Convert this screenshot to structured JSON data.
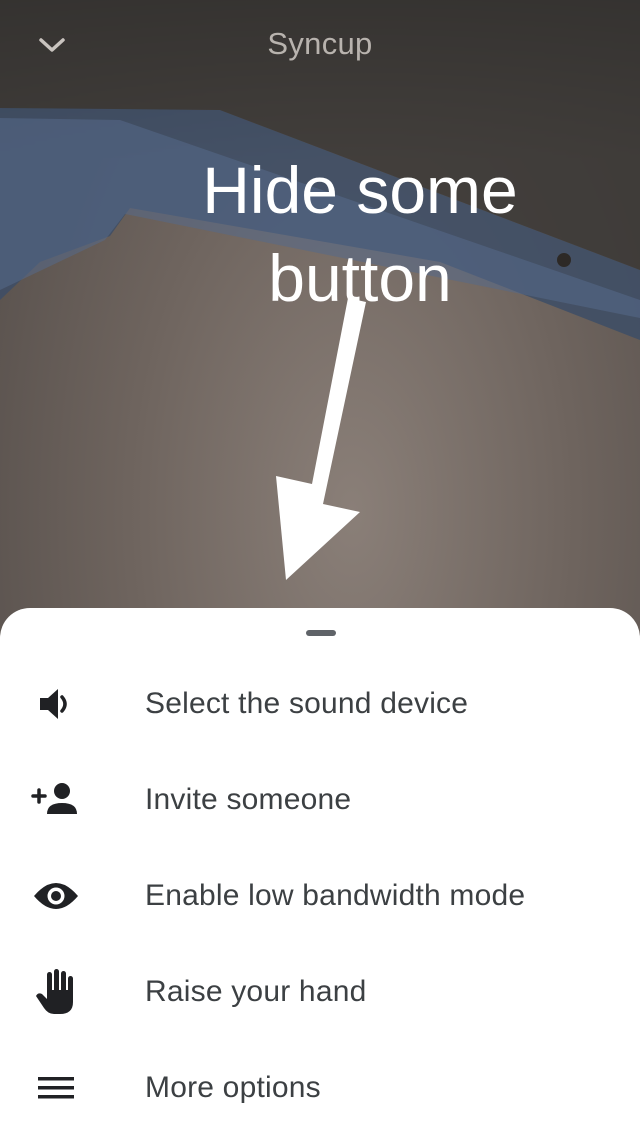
{
  "header": {
    "title": "Syncup"
  },
  "annotation": {
    "line1": "Hide some",
    "line2": "button"
  },
  "menu": {
    "items": [
      {
        "label": "Select the sound device",
        "icon": "speaker-icon"
      },
      {
        "label": "Invite someone",
        "icon": "add-person-icon"
      },
      {
        "label": "Enable low bandwidth mode",
        "icon": "eye-icon"
      },
      {
        "label": "Raise your hand",
        "icon": "hand-icon"
      },
      {
        "label": "More options",
        "icon": "menu-icon"
      }
    ]
  },
  "colors": {
    "sheet_background": "#ffffff",
    "menu_text": "#3c4043",
    "icon": "#202124",
    "annotation": "#ffffff"
  }
}
